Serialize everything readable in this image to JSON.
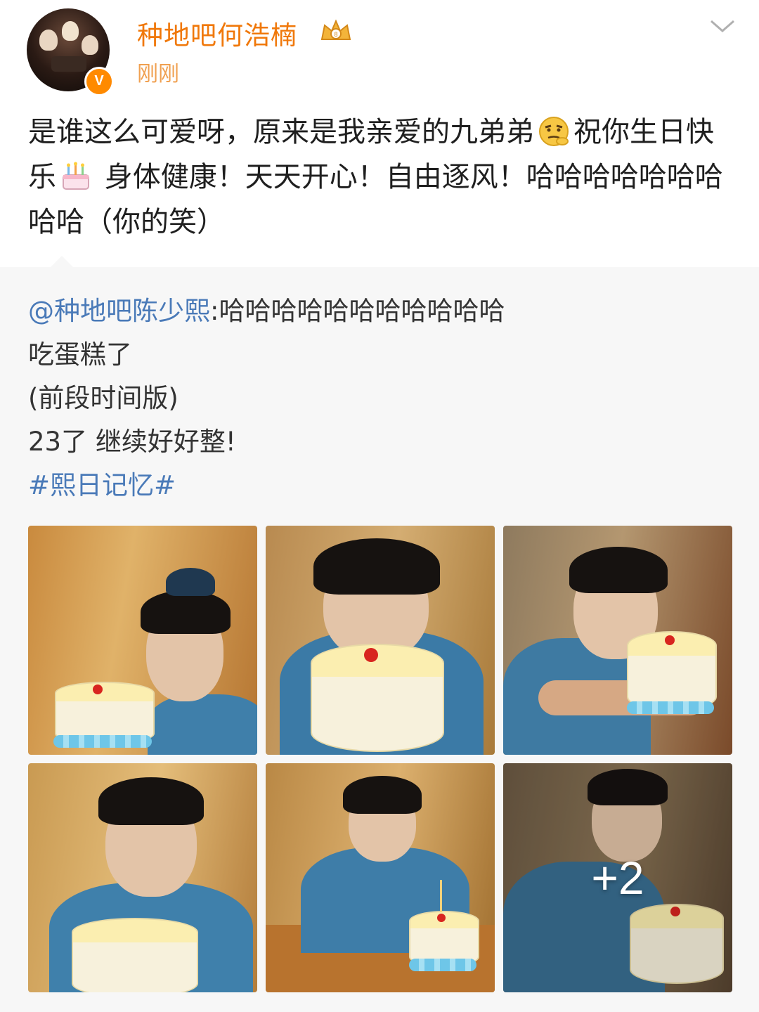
{
  "post": {
    "username": "种地吧何浩楠",
    "timestamp": "刚刚",
    "verified_badge": "V",
    "text_part1": "是谁这么可爱呀，原来是我亲爱的九弟弟",
    "text_part2": "祝你生日快乐",
    "text_part3": " 身体健康！天天开心！自由逐风！哈哈哈哈哈哈哈哈哈（你的笑）"
  },
  "repost": {
    "mention": "@种地吧陈少熙",
    "first_line_rest": ":哈哈哈哈哈哈哈哈哈哈哈",
    "line2": "吃蛋糕了",
    "line3": "(前段时间版)",
    "line4": "23了 继续好好整!",
    "hashtag": "#熙日记忆#"
  },
  "photos": {
    "more_count_label": "+2"
  },
  "colors": {
    "username": "#f0780a",
    "timestamp": "#f0a050",
    "link_blue": "#4a7ab8",
    "repost_bg": "#f7f7f7"
  },
  "icons": [
    "avatar",
    "verified-badge-icon",
    "vip-crown-icon",
    "chevron-down-icon",
    "emoji-thinking-icon",
    "emoji-cake-icon"
  ]
}
